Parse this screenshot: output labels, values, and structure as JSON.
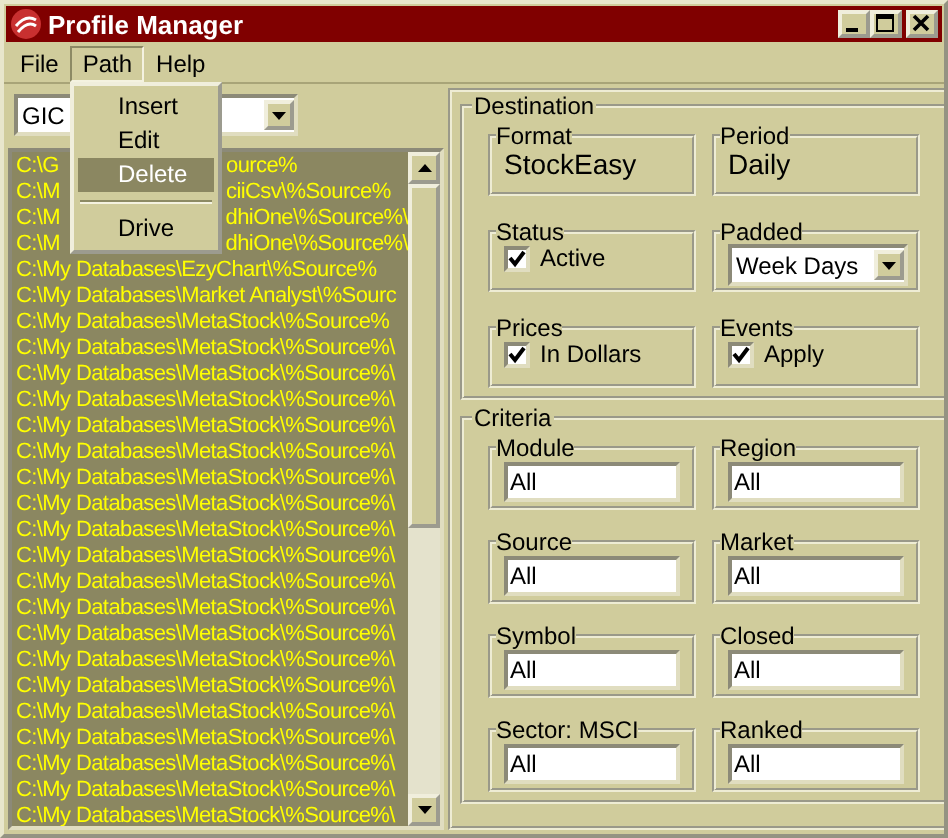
{
  "window": {
    "title": "Profile Manager"
  },
  "menu": [
    {
      "label": "File",
      "selected": false
    },
    {
      "label": "Path",
      "selected": true
    },
    {
      "label": "Help",
      "selected": false
    }
  ],
  "path_menu": {
    "items": [
      {
        "kind": "item",
        "label": "Insert",
        "selected": false
      },
      {
        "kind": "item",
        "label": "Edit",
        "selected": false
      },
      {
        "kind": "item",
        "label": "Delete",
        "selected": true
      },
      {
        "kind": "separator"
      },
      {
        "kind": "item",
        "label": "Drive",
        "selected": false
      }
    ]
  },
  "profile_combo": {
    "value": "GIC"
  },
  "paths": [
    {
      "text": "C:\\G",
      "tail": "ource%"
    },
    {
      "text": "C:\\M",
      "tail": "ciiCsv\\%Source%"
    },
    {
      "text": "C:\\M",
      "tail": "dhiOne\\%Source%\\"
    },
    {
      "text": "C:\\M",
      "tail": "dhiOne\\%Source%\\"
    },
    {
      "text": "C:\\My Databases\\EzyChart\\%Source%"
    },
    {
      "text": "C:\\My Databases\\Market Analyst\\%Sourc"
    },
    {
      "text": "C:\\My Databases\\MetaStock\\%Source%"
    },
    {
      "text": "C:\\My Databases\\MetaStock\\%Source%\\"
    },
    {
      "text": "C:\\My Databases\\MetaStock\\%Source%\\"
    },
    {
      "text": "C:\\My Databases\\MetaStock\\%Source%\\"
    },
    {
      "text": "C:\\My Databases\\MetaStock\\%Source%\\"
    },
    {
      "text": "C:\\My Databases\\MetaStock\\%Source%\\"
    },
    {
      "text": "C:\\My Databases\\MetaStock\\%Source%\\"
    },
    {
      "text": "C:\\My Databases\\MetaStock\\%Source%\\"
    },
    {
      "text": "C:\\My Databases\\MetaStock\\%Source%\\"
    },
    {
      "text": "C:\\My Databases\\MetaStock\\%Source%\\"
    },
    {
      "text": "C:\\My Databases\\MetaStock\\%Source%\\"
    },
    {
      "text": "C:\\My Databases\\MetaStock\\%Source%\\"
    },
    {
      "text": "C:\\My Databases\\MetaStock\\%Source%\\"
    },
    {
      "text": "C:\\My Databases\\MetaStock\\%Source%\\"
    },
    {
      "text": "C:\\My Databases\\MetaStock\\%Source%\\"
    },
    {
      "text": "C:\\My Databases\\MetaStock\\%Source%\\"
    },
    {
      "text": "C:\\My Databases\\MetaStock\\%Source%\\"
    },
    {
      "text": "C:\\My Databases\\MetaStock\\%Source%\\"
    },
    {
      "text": "C:\\My Databases\\MetaStock\\%Source%\\"
    },
    {
      "text": "C:\\My Databases\\MetaStock\\%Source%\\"
    }
  ],
  "destination": {
    "title": "Destination",
    "groups": [
      {
        "kind": "text",
        "label": "Format",
        "value": "StockEasy"
      },
      {
        "kind": "text",
        "label": "Period",
        "value": "Daily"
      },
      {
        "kind": "check",
        "label": "Status",
        "option": "Active",
        "checked": true
      },
      {
        "kind": "combo",
        "label": "Padded",
        "value": "Week Days"
      },
      {
        "kind": "check",
        "label": "Prices",
        "option": "In Dollars",
        "checked": true
      },
      {
        "kind": "check",
        "label": "Events",
        "option": "Apply",
        "checked": true
      }
    ]
  },
  "criteria": {
    "title": "Criteria",
    "fields": [
      {
        "label": "Module",
        "value": "All"
      },
      {
        "label": "Region",
        "value": "All"
      },
      {
        "label": "Source",
        "value": "All"
      },
      {
        "label": "Market",
        "value": "All"
      },
      {
        "label": "Symbol",
        "value": "All"
      },
      {
        "label": "Closed",
        "value": "All"
      },
      {
        "label": "Sector: MSCI",
        "value": "All"
      },
      {
        "label": "Ranked",
        "value": "All"
      }
    ]
  }
}
